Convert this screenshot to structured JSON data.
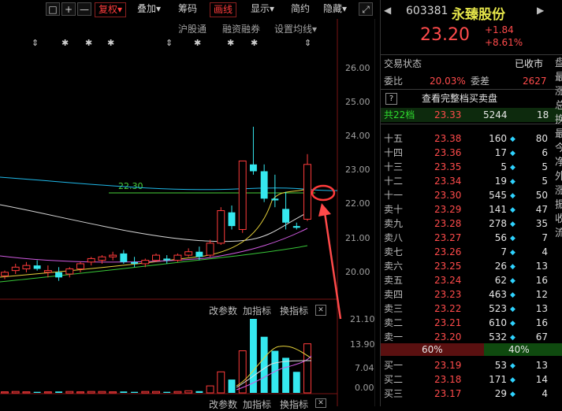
{
  "toolbar": {
    "buttons": [
      "□",
      "+",
      "—"
    ],
    "items": [
      "复权",
      "叠加",
      "筹码",
      "画线",
      "显示",
      "简约",
      "隐藏"
    ],
    "dropdown_arrow": "▾",
    "expand_icon": "⤢"
  },
  "chart_links": {
    "hgt": "沪股通",
    "rzrq": "融资融券",
    "ma_setting": "设置均线",
    "arrow": "▾"
  },
  "price_axis": [
    "26.00",
    "25.00",
    "24.00",
    "23.00",
    "22.00",
    "21.00",
    "20.00"
  ],
  "hline_label": "22.30",
  "volume_panel": {
    "params": "改参数",
    "add_indicator": "加指标",
    "switch_indicator": "换指标",
    "close": "✕",
    "axis": [
      "21.10",
      "13.90",
      "7.04",
      "0.00"
    ]
  },
  "bottom_panel": {
    "params": "改参数",
    "add_indicator": "加指标",
    "switch_indicator": "换指标",
    "close": "✕"
  },
  "chart_data": {
    "type": "candlestick",
    "ylim": [
      19.7,
      26.4
    ],
    "candles": [
      {
        "o": 19.95,
        "h": 20.1,
        "l": 19.85,
        "c": 20.05
      },
      {
        "o": 20.1,
        "h": 20.3,
        "l": 20.0,
        "c": 20.2
      },
      {
        "o": 20.15,
        "h": 20.35,
        "l": 20.05,
        "c": 20.25
      },
      {
        "o": 20.25,
        "h": 20.4,
        "l": 20.1,
        "c": 20.15
      },
      {
        "o": 20.05,
        "h": 20.25,
        "l": 19.9,
        "c": 20.1
      },
      {
        "o": 20.05,
        "h": 20.2,
        "l": 19.8,
        "c": 19.9
      },
      {
        "o": 20.0,
        "h": 20.2,
        "l": 19.9,
        "c": 20.15
      },
      {
        "o": 20.15,
        "h": 20.35,
        "l": 20.05,
        "c": 20.3
      },
      {
        "o": 20.35,
        "h": 20.5,
        "l": 20.25,
        "c": 20.45
      },
      {
        "o": 20.4,
        "h": 20.55,
        "l": 20.3,
        "c": 20.5
      },
      {
        "o": 20.5,
        "h": 20.65,
        "l": 20.4,
        "c": 20.55
      },
      {
        "o": 20.6,
        "h": 20.7,
        "l": 20.3,
        "c": 20.35
      },
      {
        "o": 20.35,
        "h": 20.5,
        "l": 20.2,
        "c": 20.3
      },
      {
        "o": 20.3,
        "h": 20.45,
        "l": 20.2,
        "c": 20.4
      },
      {
        "o": 20.4,
        "h": 20.6,
        "l": 20.35,
        "c": 20.55
      },
      {
        "o": 20.45,
        "h": 20.55,
        "l": 20.3,
        "c": 20.4
      },
      {
        "o": 20.4,
        "h": 20.6,
        "l": 20.35,
        "c": 20.55
      },
      {
        "o": 20.55,
        "h": 20.75,
        "l": 20.5,
        "c": 20.65
      },
      {
        "o": 20.65,
        "h": 20.8,
        "l": 20.4,
        "c": 20.5
      },
      {
        "o": 20.55,
        "h": 21.0,
        "l": 20.5,
        "c": 20.9
      },
      {
        "o": 20.9,
        "h": 21.95,
        "l": 20.85,
        "c": 21.85
      },
      {
        "o": 21.8,
        "h": 22.0,
        "l": 21.3,
        "c": 21.4
      },
      {
        "o": 21.3,
        "h": 23.3,
        "l": 21.2,
        "c": 23.3
      },
      {
        "o": 23.2,
        "h": 24.3,
        "l": 22.9,
        "c": 23.0
      },
      {
        "o": 23.0,
        "h": 23.2,
        "l": 22.1,
        "c": 22.2
      },
      {
        "o": 22.2,
        "h": 22.9,
        "l": 21.95,
        "c": 22.15
      },
      {
        "o": 21.9,
        "h": 22.4,
        "l": 21.3,
        "c": 21.5
      },
      {
        "o": 21.4,
        "h": 21.5,
        "l": 21.3,
        "c": 21.35
      },
      {
        "o": 21.6,
        "h": 23.5,
        "l": 21.55,
        "c": 23.2
      }
    ],
    "volumes": [
      0.3,
      0.4,
      0.3,
      0.3,
      0.3,
      0.4,
      0.4,
      0.3,
      0.4,
      0.4,
      0.3,
      0.4,
      0.3,
      0.4,
      0.4,
      0.3,
      0.4,
      0.6,
      0.5,
      2.0,
      6.0,
      3.8,
      12.0,
      21.1,
      16.0,
      12.0,
      10.0,
      6.0,
      14.0
    ]
  },
  "quote": {
    "code": "603381",
    "name": "永臻股份",
    "price": "23.20",
    "change": "+1.84",
    "change_pct": "+8.61%",
    "status_label": "交易状态",
    "status_value": "已收市",
    "wb_label": "委比",
    "wb_value": "20.03%",
    "wc_label": "委差",
    "wc_value": "2627",
    "help": "?",
    "full_book": "查看完整档买卖盘",
    "total_label": "共22档",
    "total_price": "23.33",
    "total_vol": "5244",
    "total_count": "18",
    "asks": [
      {
        "label": "十五",
        "price": "23.38",
        "vol": "160",
        "count": "80"
      },
      {
        "label": "十四",
        "price": "23.36",
        "vol": "17",
        "count": "6"
      },
      {
        "label": "十三",
        "price": "23.35",
        "vol": "5",
        "count": "5"
      },
      {
        "label": "十二",
        "price": "23.34",
        "vol": "19",
        "count": "5"
      },
      {
        "label": "十一",
        "price": "23.30",
        "vol": "545",
        "count": "50"
      },
      {
        "label": "卖十",
        "price": "23.29",
        "vol": "141",
        "count": "47"
      },
      {
        "label": "卖九",
        "price": "23.28",
        "vol": "278",
        "count": "35"
      },
      {
        "label": "卖八",
        "price": "23.27",
        "vol": "56",
        "count": "7"
      },
      {
        "label": "卖七",
        "price": "23.26",
        "vol": "7",
        "count": "4"
      },
      {
        "label": "卖六",
        "price": "23.25",
        "vol": "26",
        "count": "13"
      },
      {
        "label": "卖五",
        "price": "23.24",
        "vol": "62",
        "count": "16"
      },
      {
        "label": "卖四",
        "price": "23.23",
        "vol": "463",
        "count": "12"
      },
      {
        "label": "卖三",
        "price": "23.22",
        "vol": "523",
        "count": "13"
      },
      {
        "label": "卖二",
        "price": "23.21",
        "vol": "610",
        "count": "16"
      },
      {
        "label": "卖一",
        "price": "23.20",
        "vol": "532",
        "count": "67"
      }
    ],
    "ratio_left": "60%",
    "ratio_right": "40%",
    "bids": [
      {
        "label": "买一",
        "price": "23.19",
        "vol": "53",
        "count": "13"
      },
      {
        "label": "买二",
        "price": "23.18",
        "vol": "171",
        "count": "14"
      },
      {
        "label": "买三",
        "price": "23.17",
        "vol": "29",
        "count": "4"
      }
    ],
    "side_chars": [
      "盘",
      "最",
      "涨",
      "总",
      "换",
      "最",
      "今",
      "净",
      "外",
      "涨",
      "振",
      "收",
      "流"
    ],
    "nav_prev": "◀",
    "nav_next": "▶"
  }
}
